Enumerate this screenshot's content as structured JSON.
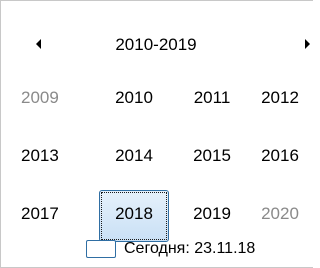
{
  "calendar": {
    "view": "decade",
    "header": {
      "title": "2010-2019",
      "prev_icon": "triangle-left-icon",
      "next_icon": "triangle-right-icon"
    },
    "years": [
      {
        "label": "2009",
        "muted": true,
        "selected": false
      },
      {
        "label": "2010",
        "muted": false,
        "selected": false
      },
      {
        "label": "2011",
        "muted": false,
        "selected": false
      },
      {
        "label": "2012",
        "muted": false,
        "selected": false
      },
      {
        "label": "2013",
        "muted": false,
        "selected": false
      },
      {
        "label": "2014",
        "muted": false,
        "selected": false
      },
      {
        "label": "2015",
        "muted": false,
        "selected": false
      },
      {
        "label": "2016",
        "muted": false,
        "selected": false
      },
      {
        "label": "2017",
        "muted": false,
        "selected": false
      },
      {
        "label": "2018",
        "muted": false,
        "selected": true
      },
      {
        "label": "2019",
        "muted": false,
        "selected": false
      },
      {
        "label": "2020",
        "muted": true,
        "selected": false
      }
    ],
    "today": {
      "text": "Сегодня: 23.11.18"
    },
    "colors": {
      "selection_border": "#2f6ea3",
      "selection_fill": "#c9e0f5",
      "muted_text": "#8a8a8a",
      "today_border": "#2f6ea3"
    }
  }
}
